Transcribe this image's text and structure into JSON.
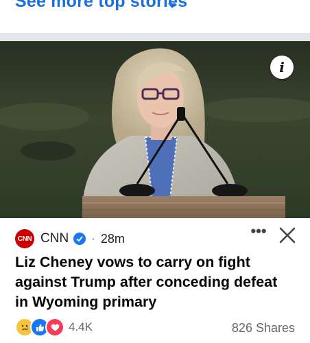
{
  "feed_header": {
    "see_more_label": "See more top stories"
  },
  "post": {
    "source": "CNN",
    "source_logo_text": "CNN",
    "separator": "·",
    "time_ago": "28m",
    "more_glyph": "•••",
    "headline": "Liz Cheney vows to carry on fight against Trump after conceding defeat in Wyoming primary",
    "info_glyph": "i",
    "reactions_count": "4.4K",
    "shares": "826 Shares"
  },
  "colors": {
    "link_blue": "#1a6ee0",
    "verified_blue": "#1877f2",
    "cnn_red": "#cc0000",
    "secondary_text": "#65676b"
  },
  "icons": [
    "chevron-down-icon",
    "info-icon",
    "verified-badge-icon",
    "more-icon",
    "close-icon",
    "sad-reaction-icon",
    "like-reaction-icon",
    "love-reaction-icon"
  ]
}
